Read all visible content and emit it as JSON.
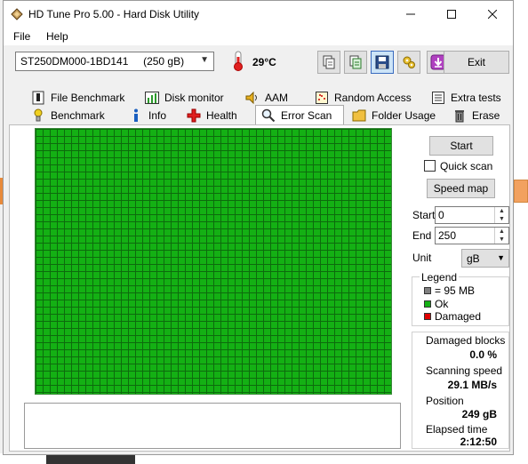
{
  "window": {
    "title": "HD Tune Pro 5.00 - Hard Disk Utility",
    "minimize_icon": "minimize-icon",
    "maximize_icon": "maximize-icon",
    "close_icon": "close-icon"
  },
  "menu": {
    "file": "File",
    "help": "Help"
  },
  "toolbar": {
    "drive": "ST250DM000-1BD141     (250 gB)",
    "temperature": "29°C",
    "buttons": [
      "copy-icon",
      "copy-info-icon",
      "save-icon",
      "options-icon",
      "download-icon"
    ],
    "exit_label": "Exit"
  },
  "tabs_row1": [
    {
      "label": "File Benchmark",
      "icon": "file-benchmark-icon"
    },
    {
      "label": "Disk monitor",
      "icon": "disk-monitor-icon"
    },
    {
      "label": "AAM",
      "icon": "speaker-icon"
    },
    {
      "label": "Random Access",
      "icon": "random-access-icon"
    },
    {
      "label": "Extra tests",
      "icon": "extra-tests-icon"
    }
  ],
  "tabs_row2": [
    {
      "label": "Benchmark",
      "icon": "benchmark-icon"
    },
    {
      "label": "Info",
      "icon": "info-icon"
    },
    {
      "label": "Health",
      "icon": "health-icon"
    },
    {
      "label": "Error Scan",
      "icon": "magnifier-icon",
      "active": true
    },
    {
      "label": "Folder Usage",
      "icon": "folder-icon"
    },
    {
      "label": "Erase",
      "icon": "trash-icon"
    }
  ],
  "error_scan": {
    "start_button": "Start",
    "quick_scan_label": "Quick scan",
    "quick_scan_checked": false,
    "speed_map_button": "Speed map",
    "start_label": "Start",
    "start_value": "0",
    "end_label": "End",
    "end_value": "250",
    "unit_label": "Unit",
    "unit_value": "gB",
    "legend": {
      "title": "Legend",
      "items": [
        {
          "label": "= 95 MB",
          "color": "#808080"
        },
        {
          "label": "Ok",
          "color": "#14b014"
        },
        {
          "label": "Damaged",
          "color": "#e00000"
        }
      ]
    },
    "stats": {
      "damaged_blocks_label": "Damaged blocks",
      "damaged_blocks_value": "0.0 %",
      "scanning_speed_label": "Scanning speed",
      "scanning_speed_value": "29.1 MB/s",
      "position_label": "Position",
      "position_value": "249 gB",
      "elapsed_label": "Elapsed time",
      "elapsed_value": "2:12:50"
    },
    "grid_status": "all blocks ok",
    "grid_color": "#14b014"
  }
}
